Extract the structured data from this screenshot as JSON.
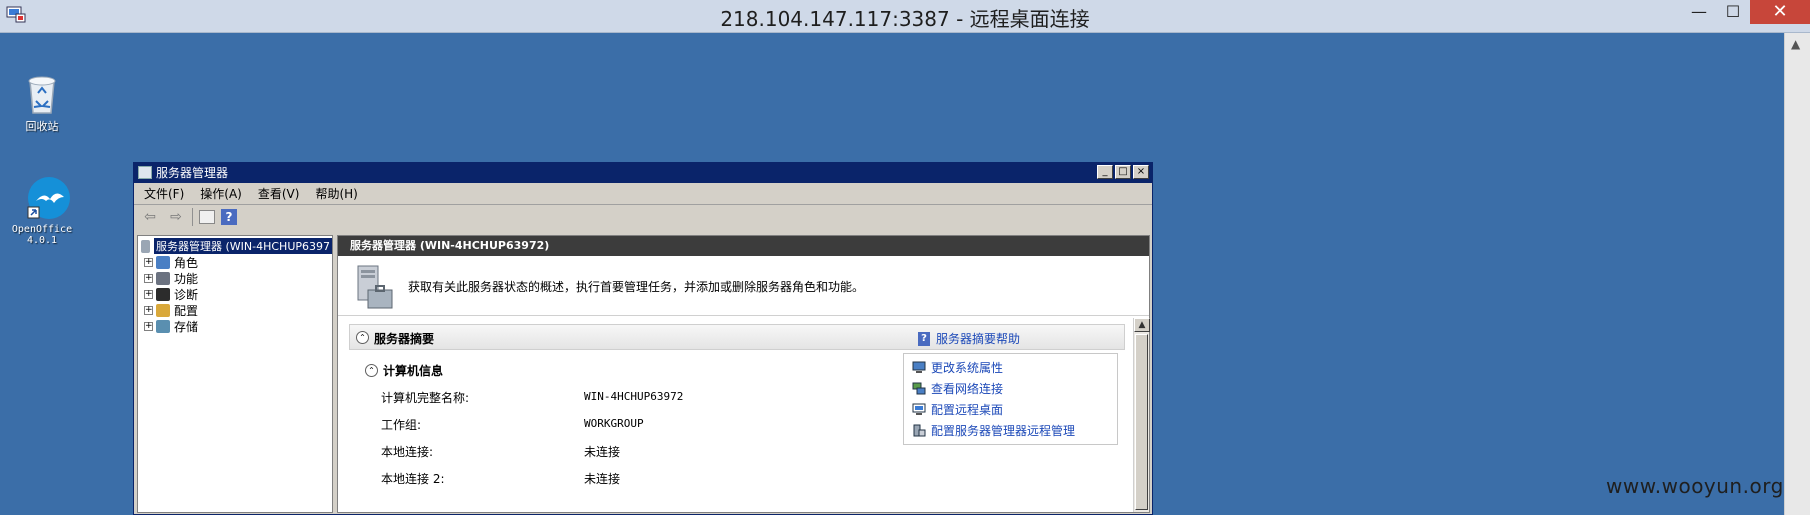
{
  "rdp": {
    "title": "218.104.147.117:3387 - 远程桌面连接",
    "minimize": "—",
    "maximize": "☐",
    "close": "✕"
  },
  "desktop": {
    "icons": [
      {
        "label": "回收站",
        "icon": "recycle-bin-icon"
      },
      {
        "label_line1": "OpenOffice",
        "label_line2": "4.0.1",
        "icon": "openoffice-icon"
      }
    ]
  },
  "window": {
    "title": "服务器管理器",
    "menu": [
      "文件(F)",
      "操作(A)",
      "查看(V)",
      "帮助(H)"
    ],
    "toolbar": {
      "back": "⇦",
      "forward": "⇨",
      "help": "?"
    },
    "tree": {
      "root": "服务器管理器 (WIN-4HCHUP6397",
      "items": [
        {
          "label": "角色",
          "icon": "roles-icon"
        },
        {
          "label": "功能",
          "icon": "features-icon"
        },
        {
          "label": "诊断",
          "icon": "diagnostics-icon"
        },
        {
          "label": "配置",
          "icon": "configuration-icon"
        },
        {
          "label": "存储",
          "icon": "storage-icon"
        }
      ]
    },
    "pane": {
      "header": "服务器管理器 (WIN-4HCHUP63972)",
      "description": "获取有关此服务器状态的概述，执行首要管理任务，并添加或删除服务器角色和功能。",
      "summary_title": "服务器摘要",
      "summary_help": "服务器摘要帮助",
      "computer_info_title": "计算机信息",
      "rows": [
        {
          "label": "计算机完整名称:",
          "value": "WIN-4HCHUP63972"
        },
        {
          "label": "工作组:",
          "value": "WORKGROUP"
        },
        {
          "label": "本地连接:",
          "value": "未连接"
        },
        {
          "label": "本地连接 2:",
          "value": "未连接"
        }
      ],
      "tasks": [
        "更改系统属性",
        "查看网络连接",
        "配置远程桌面",
        "配置服务器管理器远程管理"
      ]
    }
  },
  "watermark": "www.wooyun.org",
  "colors": {
    "desktop": "#3b6ea8",
    "titlebar": "#0a246a",
    "link": "#1c49b8"
  }
}
